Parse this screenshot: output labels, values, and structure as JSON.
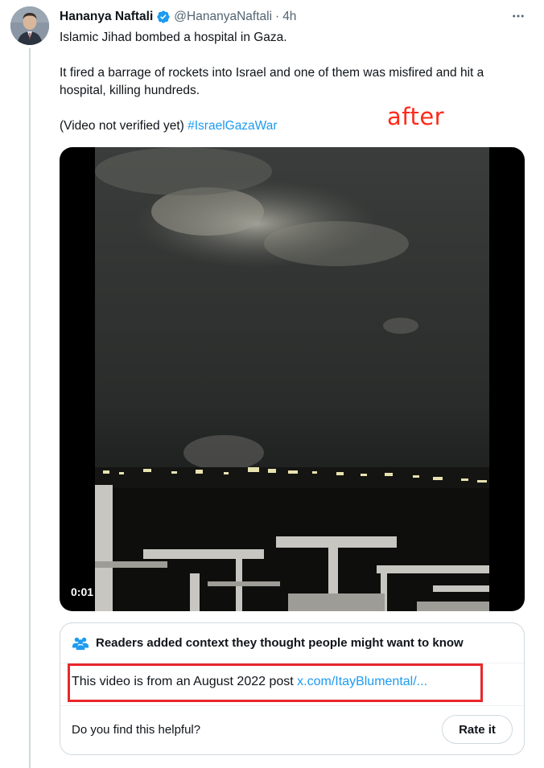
{
  "tweet": {
    "author_name": "Hananya Naftali",
    "handle": "@HananyaNaftali",
    "separator": "·",
    "time": "4h",
    "verified_icon": "verified-badge-icon",
    "more_icon": "more-dots-icon",
    "text_line1": "Islamic Jihad bombed a hospital in Gaza.",
    "text_line2": "It fired a barrage of rockets into Israel and one of them was misfired and hit a hospital, killing hundreds.",
    "text_line3": "(Video not verified yet)",
    "hashtag": "#IsraelGazaWar"
  },
  "annotation": {
    "label": "after",
    "color": "#ff2a1a",
    "highlight_color": "#e8272a"
  },
  "video": {
    "timestamp": "0:01"
  },
  "community_note": {
    "icon": "people-icon",
    "title": "Readers added context they thought people might want to know",
    "body_text": "This video is from an August 2022 post",
    "link_text": "x.com/ItayBlumental/...",
    "helpful_question": "Do you find this helpful?",
    "rate_button": "Rate it"
  },
  "colors": {
    "accent": "#1d9bf0",
    "text": "#0f1419",
    "secondary_text": "#536471",
    "border": "#cfd9de"
  }
}
